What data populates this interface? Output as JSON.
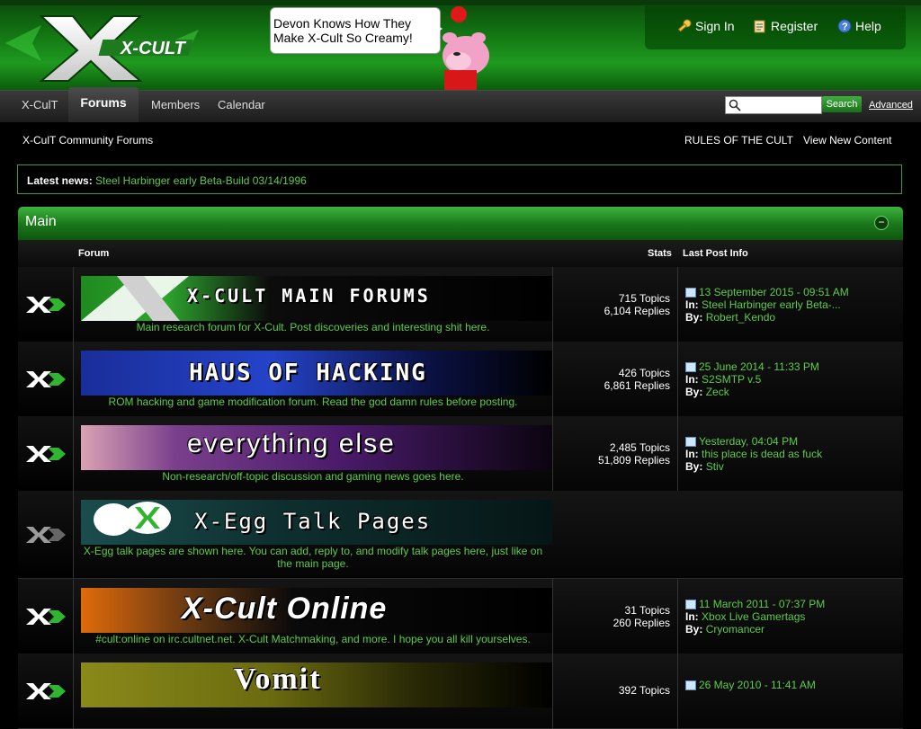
{
  "header": {
    "logo_text": "X-CULT",
    "bubble_text": "Devon Knows How They Make X-Cult So Creamy!",
    "user_links": [
      {
        "label": "Sign In",
        "icon": "key-icon"
      },
      {
        "label": "Register",
        "icon": "register-icon"
      },
      {
        "label": "Help",
        "icon": "help-icon"
      }
    ]
  },
  "nav": {
    "tabs": [
      "X-CulT",
      "Forums",
      "Members",
      "Calendar"
    ],
    "active_tab": "Forums",
    "search_placeholder": "",
    "search_button": "Search",
    "advanced_link": "Advanced"
  },
  "breadcrumb": {
    "title": "X-CulT Community Forums",
    "rules_link": "RULES OF THE CULT",
    "new_content_link": "View New Content"
  },
  "news": {
    "label": "Latest news:",
    "link": "Steel Harbinger early Beta-Build 03/14/1996"
  },
  "category": {
    "title": "Main",
    "toggle": "−",
    "columns": {
      "forum": "Forum",
      "stats": "Stats",
      "last_post": "Last Post Info"
    }
  },
  "forums": [
    {
      "banner_text": "X-CULT MAIN FORUMS",
      "description": "Main research forum for X-Cult. Post discoveries and interesting shit here.",
      "topics": "715 Topics",
      "replies": "6,104 Replies",
      "last_date": "13 September 2015 - 09:51 AM",
      "in_label": "In:",
      "in_topic": "Steel Harbinger early Beta-...",
      "by_label": "By:",
      "by_user": "Robert_Kendo"
    },
    {
      "banner_text": "HAUS OF HACKING",
      "description": "ROM hacking and game modification forum. Read the god damn rules before posting.",
      "topics": "426 Topics",
      "replies": "6,861 Replies",
      "last_date": "25 June 2014 - 11:33 PM",
      "in_label": "In:",
      "in_topic": "S2SMTP v.5",
      "by_label": "By:",
      "by_user": "Zeck"
    },
    {
      "banner_text": "everything else",
      "description": "Non-research/off-topic discussion and gaming news goes here.",
      "topics": "2,485 Topics",
      "replies": "51,809 Replies",
      "last_date": "Yesterday, 04:04 PM",
      "in_label": "In:",
      "in_topic": "this place is dead as fuck",
      "by_label": "By:",
      "by_user": "Stiv"
    },
    {
      "banner_text": "X-Egg Talk Pages",
      "description": "X-Egg talk pages are shown here. You can add, reply to, and modify talk pages here, just like on the main page.",
      "topics": "",
      "replies": "",
      "last_date": "",
      "in_label": "",
      "in_topic": "",
      "by_label": "",
      "by_user": ""
    },
    {
      "banner_text": "X-Cult Online",
      "description": "#cult:online on irc.cultnet.net. X-Cult Matchmaking, and more. I hope you all kill yourselves.",
      "topics": "31 Topics",
      "replies": "260 Replies",
      "last_date": "11 March 2011 - 07:37 PM",
      "in_label": "In:",
      "in_topic": "Xbox Live Gamertags",
      "by_label": "By:",
      "by_user": "Cryomancer"
    },
    {
      "banner_text": "Vomit",
      "description": "",
      "topics": "392 Topics",
      "replies": "",
      "last_date": "26 May 2010 - 11:41 AM",
      "in_label": "",
      "in_topic": "",
      "by_label": "",
      "by_user": ""
    }
  ]
}
